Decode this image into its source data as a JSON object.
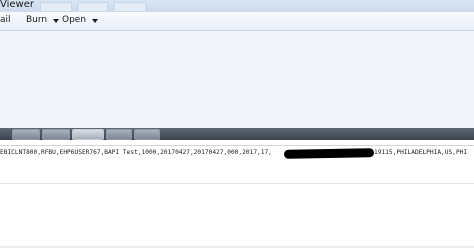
{
  "window": {
    "title": "Viewer"
  },
  "toolbar": {
    "email_label": "ail",
    "burn_label": "Burn",
    "open_label": "Open"
  },
  "document": {
    "line_prefix": "EBICLNT800,RFBU,EHP6USER767,BAPI Test,1000,20170427,20170427,000,2017,17,",
    "line_suffix": "19115,PHILADELPHIA,US,PHI"
  },
  "colors": {
    "titlebar": "#cbdaec",
    "toolbar": "#e7eef7",
    "preview_pane": "#f2f6fb",
    "taskbar": "#3b444f",
    "redaction": "#000000"
  },
  "icons": {
    "burn_dropdown": "chevron-down-icon",
    "open_dropdown": "chevron-down-icon"
  }
}
